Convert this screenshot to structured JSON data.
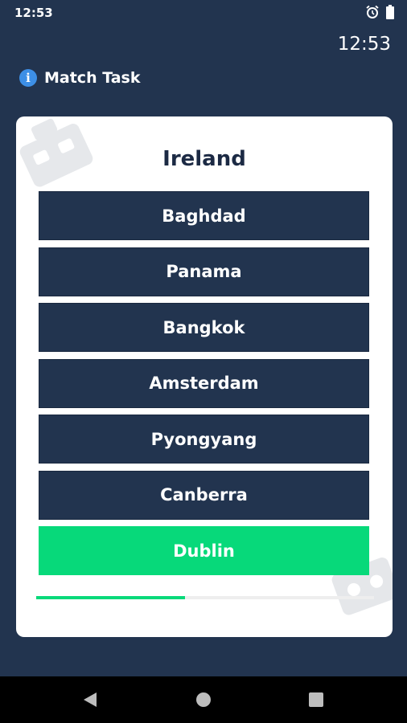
{
  "status_bar": {
    "time": "12:53",
    "icons": [
      "alarm-icon",
      "battery-icon"
    ]
  },
  "clock": "12:53",
  "header": {
    "icon": "info-icon",
    "title": "Match Task"
  },
  "quiz": {
    "question": "Ireland",
    "options": [
      {
        "label": "Baghdad",
        "selected_correct": false
      },
      {
        "label": "Panama",
        "selected_correct": false
      },
      {
        "label": "Bangkok",
        "selected_correct": false
      },
      {
        "label": "Amsterdam",
        "selected_correct": false
      },
      {
        "label": "Pyongyang",
        "selected_correct": false
      },
      {
        "label": "Canberra",
        "selected_correct": false
      },
      {
        "label": "Dublin",
        "selected_correct": true
      }
    ],
    "progress_fraction": 0.44
  },
  "nav_bar": {
    "icons": [
      "back-icon",
      "home-icon",
      "recents-icon"
    ]
  },
  "colors": {
    "background": "#22344f",
    "option_bg": "#22344f",
    "correct": "#07d97a",
    "card": "#ffffff"
  }
}
